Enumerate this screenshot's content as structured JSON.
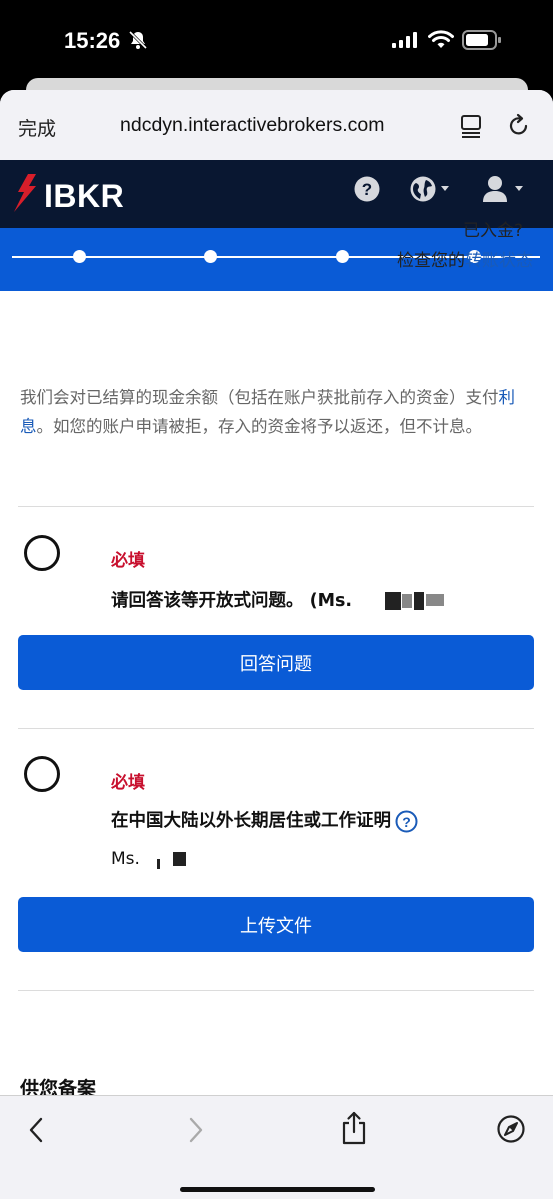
{
  "status_bar": {
    "time": "15:26"
  },
  "browser": {
    "done_label": "完成",
    "url": "ndcdyn.interactivebrokers.com"
  },
  "header": {
    "brand": "IBKR"
  },
  "deposit": {
    "question": "已入金?",
    "check_prefix": "检查您的",
    "check_link": "转账状态"
  },
  "interest_note": {
    "part1": "我们会对已结算的现金余额（包括在账户获批前存入的资金）支付",
    "link": "利息",
    "part2": "。如您的账户申请被拒，存入的资金将予以返还，但不计息。"
  },
  "tasks": [
    {
      "required_label": "必填",
      "title": "请回答该等开放式问题。 (Ms.",
      "button_label": "回答问题"
    },
    {
      "required_label": "必填",
      "title": "在中国大陆以外长期居住或工作证明",
      "name": "Ms.",
      "button_label": "上传文件"
    }
  ],
  "section_heading": "供您备案",
  "colors": {
    "header_bg": "#091731",
    "primary_blue": "#0a5bd6",
    "required_red": "#c8102e",
    "link_blue": "#1a5bb8"
  }
}
